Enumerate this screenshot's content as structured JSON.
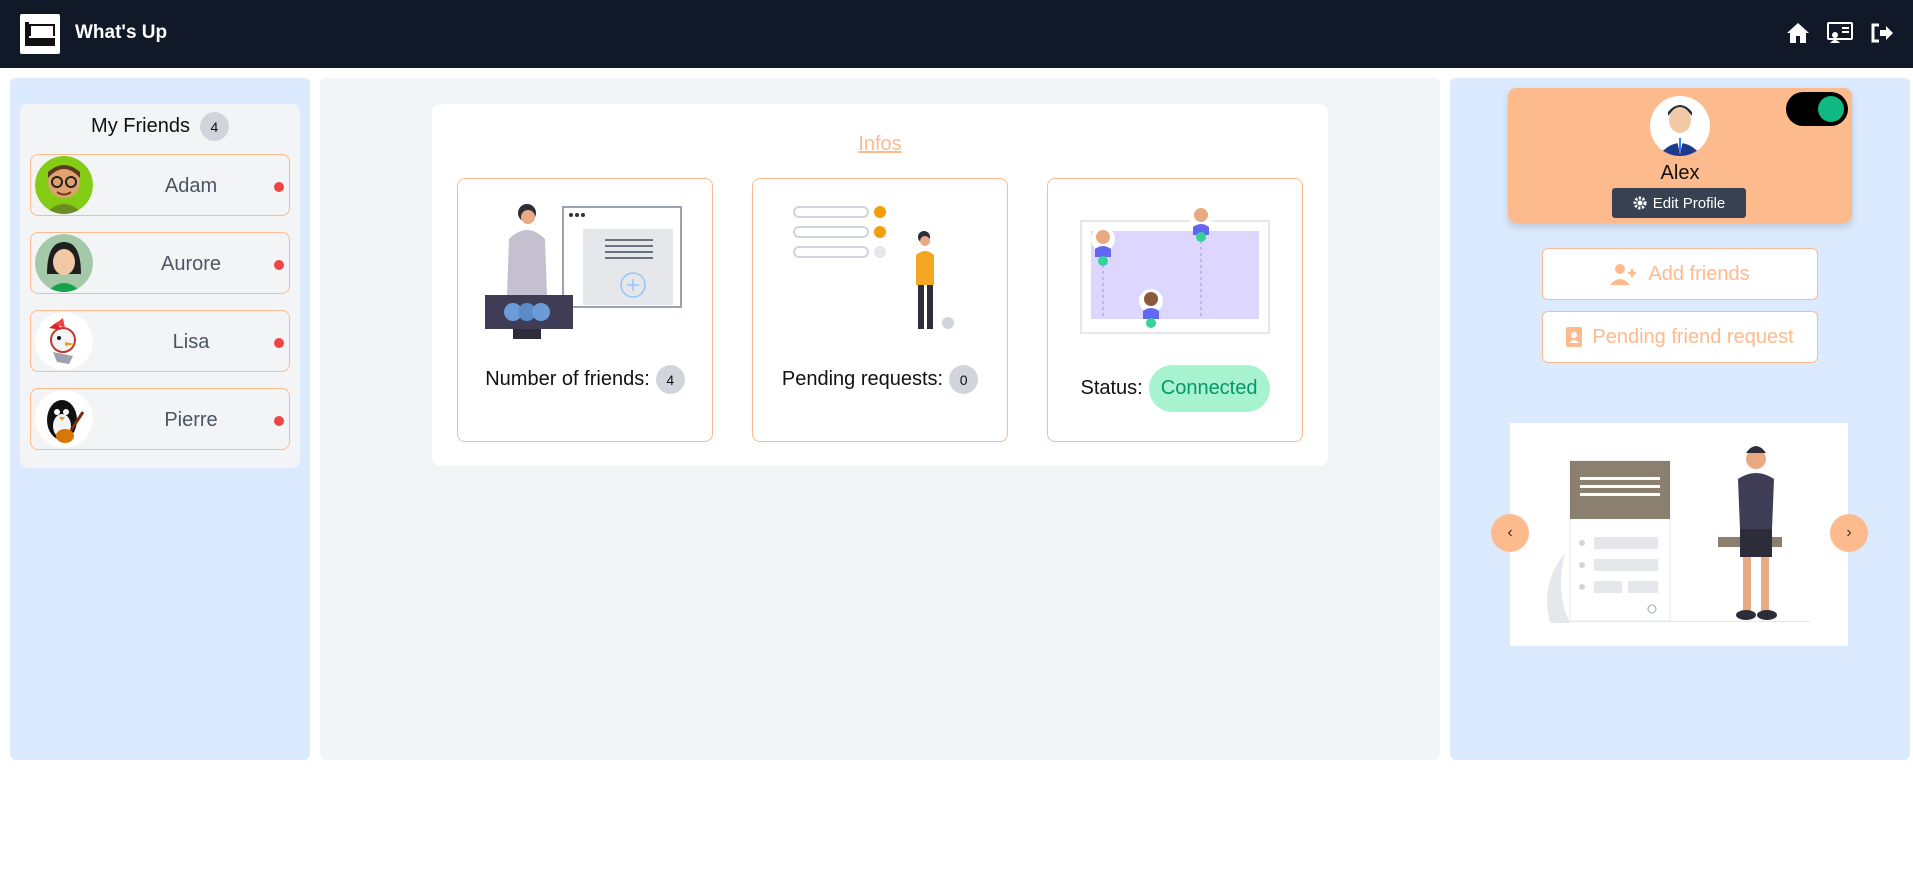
{
  "app": {
    "title": "What's Up"
  },
  "nav": {
    "icons": [
      "home-icon",
      "profile-card-icon",
      "logout-icon"
    ]
  },
  "friends": {
    "title": "My Friends",
    "count": "4",
    "items": [
      {
        "name": "Adam",
        "status": "offline"
      },
      {
        "name": "Aurore",
        "status": "offline"
      },
      {
        "name": "Lisa",
        "status": "offline"
      },
      {
        "name": "Pierre",
        "status": "offline"
      }
    ]
  },
  "infos": {
    "title": "Infos",
    "friends_label": "Number of friends:",
    "friends_count": "4",
    "pending_label": "Pending requests:",
    "pending_count": "0",
    "status_label": "Status:",
    "status_value": "Connected"
  },
  "profile": {
    "name": "Alex",
    "edit_label": "Edit Profile",
    "toggle_on": true,
    "add_friends_label": "Add friends",
    "pending_label": "Pending friend request"
  },
  "carousel": {
    "prev": "‹",
    "next": "›"
  },
  "colors": {
    "accent": "#fdba8c",
    "topbar": "#111827",
    "panel": "#dbeafe",
    "online_dot": "#ef4444",
    "connected_bg": "#a7f3d0",
    "connected_text": "#059669"
  }
}
